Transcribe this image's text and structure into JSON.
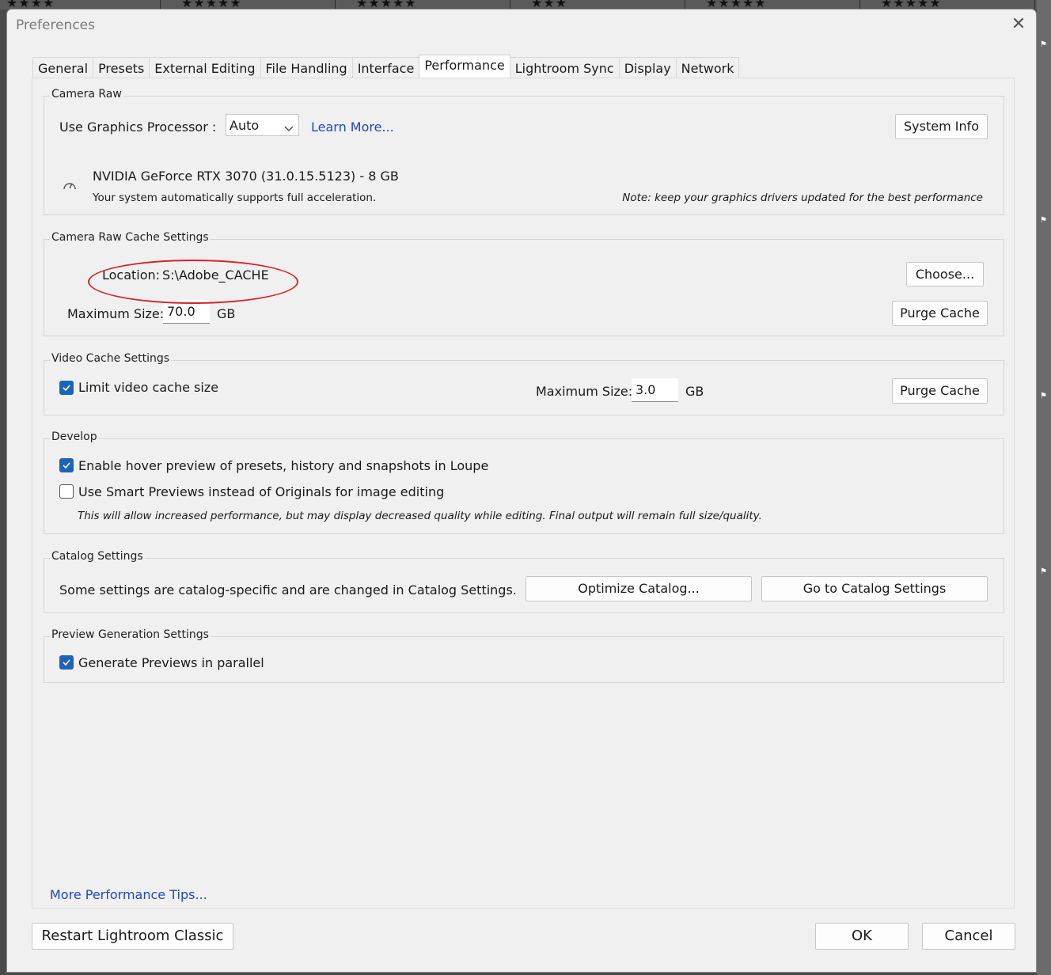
{
  "window": {
    "title": "Preferences"
  },
  "tabs": [
    {
      "label": "General"
    },
    {
      "label": "Presets"
    },
    {
      "label": "External Editing"
    },
    {
      "label": "File Handling"
    },
    {
      "label": "Interface"
    },
    {
      "label": "Performance"
    },
    {
      "label": "Lightroom Sync"
    },
    {
      "label": "Display"
    },
    {
      "label": "Network"
    }
  ],
  "active_tab": "Performance",
  "camera_raw": {
    "group_label": "Camera Raw",
    "gpu_label": "Use Graphics Processor :",
    "gpu_value": "Auto",
    "learn_more": "Learn More...",
    "system_info": "System Info",
    "gpu_name": "NVIDIA GeForce RTX 3070 (31.0.15.5123) - 8 GB",
    "support_text": "Your system automatically supports full acceleration.",
    "note": "Note: keep your graphics drivers updated for the best performance"
  },
  "cache": {
    "group_label": "Camera Raw Cache Settings",
    "location_label": "Location:",
    "location_value": "S:\\Adobe_CACHE",
    "choose": "Choose...",
    "max_size_label": "Maximum Size:",
    "max_size_value": "70.0",
    "unit": "GB",
    "purge": "Purge Cache"
  },
  "video_cache": {
    "group_label": "Video Cache Settings",
    "limit_label": "Limit video cache size",
    "limit_checked": true,
    "max_size_label": "Maximum Size:",
    "max_size_value": "3.0",
    "unit": "GB",
    "purge": "Purge Cache"
  },
  "develop": {
    "group_label": "Develop",
    "hover_label": "Enable hover preview of presets, history and snapshots in Loupe",
    "hover_checked": true,
    "smart_label": "Use Smart Previews instead of Originals for image editing",
    "smart_checked": false,
    "smart_note": "This will allow increased performance, but may display decreased quality while editing. Final output will remain full size/quality."
  },
  "catalog": {
    "group_label": "Catalog Settings",
    "text": "Some settings are catalog-specific and are changed in Catalog Settings.",
    "optimize": "Optimize Catalog...",
    "goto": "Go to Catalog Settings"
  },
  "preview": {
    "group_label": "Preview Generation Settings",
    "parallel_label": "Generate Previews in parallel",
    "parallel_checked": true
  },
  "footer": {
    "more_tips": "More Performance Tips...",
    "restart": "Restart Lightroom Classic",
    "ok": "OK",
    "cancel": "Cancel"
  },
  "background": {
    "ratings": [
      "★★★★",
      "★★★★★",
      "★★★★★",
      "★★★",
      "★★★★★",
      "★★★★★"
    ]
  },
  "colors": {
    "accent": "#1d64b5",
    "link": "#1f47c2",
    "annotation": "#d8222b"
  }
}
